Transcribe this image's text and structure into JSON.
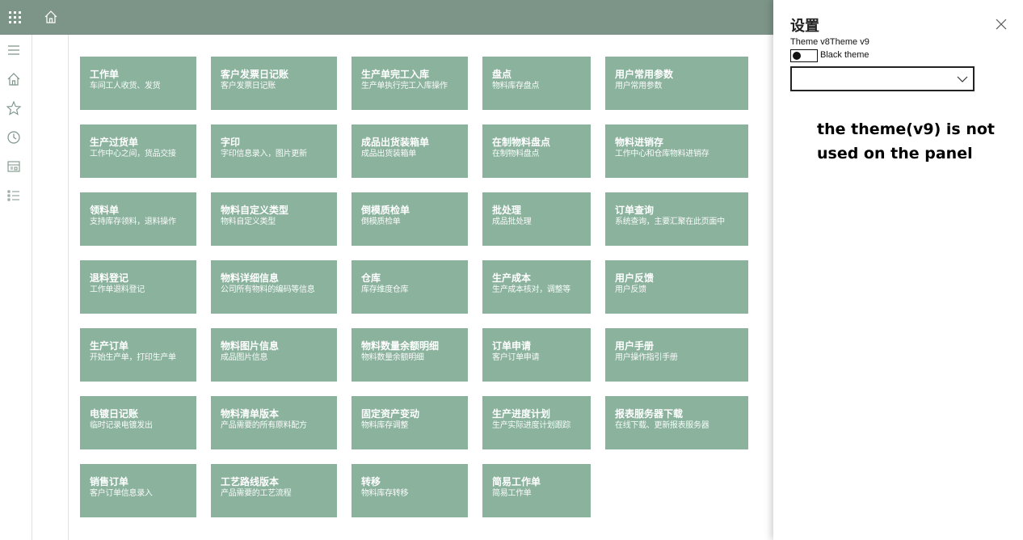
{
  "tiles": [
    {
      "title": "工作单",
      "sub": "车间工人收货、发货"
    },
    {
      "title": "客户发票日记账",
      "sub": "客户发票日记账"
    },
    {
      "title": "生产单完工入库",
      "sub": "生产单执行完工入库操作"
    },
    {
      "title": "盘点",
      "sub": "物料库存盘点"
    },
    {
      "title": "用户常用参数",
      "sub": "用户常用参数"
    },
    {
      "title": "生产过货单",
      "sub": "工作中心之间，货品交接"
    },
    {
      "title": "字印",
      "sub": "字印信息录入，图片更新"
    },
    {
      "title": "成品出货装箱单",
      "sub": "成品出货装箱单"
    },
    {
      "title": "在制物料盘点",
      "sub": "在制物料盘点"
    },
    {
      "title": "物料进销存",
      "sub": "工作中心和仓库物料进销存"
    },
    {
      "title": "领料单",
      "sub": "支持库存领料，退料操作"
    },
    {
      "title": "物料自定义类型",
      "sub": "物料自定义类型"
    },
    {
      "title": "倒模质检单",
      "sub": "倒模质检单"
    },
    {
      "title": "批处理",
      "sub": "成品批处理"
    },
    {
      "title": "订单查询",
      "sub": "系统查询，主要汇聚在此页面中"
    },
    {
      "title": "退料登记",
      "sub": "工作单退料登记"
    },
    {
      "title": "物料详细信息",
      "sub": "公司所有物料的编码等信息"
    },
    {
      "title": "仓库",
      "sub": "库存维度仓库"
    },
    {
      "title": "生产成本",
      "sub": "生产成本核对，调整等"
    },
    {
      "title": "用户反馈",
      "sub": "用户反馈"
    },
    {
      "title": "生产订单",
      "sub": "开始生产单，打印生产单"
    },
    {
      "title": "物料图片信息",
      "sub": "成品图片信息"
    },
    {
      "title": "物料数量余额明细",
      "sub": "物料数量余额明细"
    },
    {
      "title": "订单申请",
      "sub": "客户订单申请"
    },
    {
      "title": "用户手册",
      "sub": "用户操作指引手册"
    },
    {
      "title": "电镀日记账",
      "sub": "临时记录电镀发出"
    },
    {
      "title": "物料清单版本",
      "sub": "产品需要的所有原料配方"
    },
    {
      "title": "固定资产变动",
      "sub": "物料库存调整"
    },
    {
      "title": "生产进度计划",
      "sub": "生产实际进度计划跟踪"
    },
    {
      "title": "报表服务器下载",
      "sub": "在线下载、更新报表服务器"
    },
    {
      "title": "销售订单",
      "sub": "客户订单信息录入"
    },
    {
      "title": "工艺路线版本",
      "sub": "产品需要的工艺流程"
    },
    {
      "title": "转移",
      "sub": "物料库存转移"
    },
    {
      "title": "简易工作单",
      "sub": "简易工作单"
    }
  ],
  "settings": {
    "title": "设置",
    "theme_options": "Theme v8Theme v9",
    "toggle_label": "Black theme",
    "select_value": ""
  },
  "annotation": "the theme(v9) is not used on the panel",
  "colors": {
    "topbar": "#7d9488",
    "tile": "#8ab29d"
  },
  "icons": [
    "waffle-icon",
    "home-icon",
    "hamburger-icon",
    "star-icon",
    "clock-icon",
    "dashboard-icon",
    "list-icon",
    "close-icon",
    "chevron-down-icon"
  ]
}
